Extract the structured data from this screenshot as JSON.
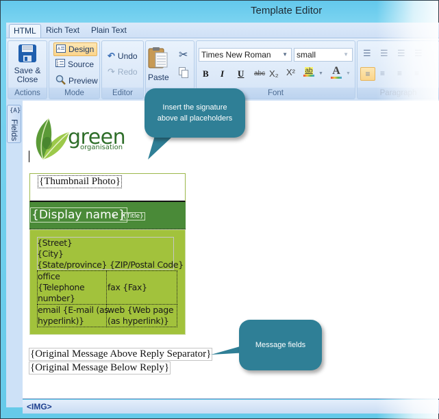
{
  "window": {
    "title": "Template Editor"
  },
  "tabs": [
    {
      "label": "HTML",
      "active": true
    },
    {
      "label": "Rich Text",
      "active": false
    },
    {
      "label": "Plain Text",
      "active": false
    }
  ],
  "ribbon": {
    "actions": {
      "label": "Actions",
      "save_close": "Save &\nClose",
      "save_line1": "Save &",
      "save_line2": "Close"
    },
    "mode": {
      "label": "Mode",
      "design": "Design",
      "source": "Source",
      "preview": "Preview",
      "selected": "Design"
    },
    "editor": {
      "label": "Editor",
      "undo": "Undo",
      "redo": "Redo"
    },
    "clipboard": {
      "paste": "Paste"
    },
    "font": {
      "label": "Font",
      "family": "Times New Roman",
      "size": "small",
      "bold": "B",
      "italic": "I",
      "underline": "U",
      "strike": "abc",
      "subscript": "X₂",
      "superscript": "X²",
      "highlight": "ab",
      "font_color": "A"
    },
    "paragraph": {
      "label": "Paragraph",
      "selected_align": "left"
    }
  },
  "side_panel": {
    "fields_label": "Fields",
    "fields_icon": "{A}"
  },
  "content": {
    "logo_text": "green",
    "logo_sub": "organisation",
    "thumbnail": "{Thumbnail Photo}",
    "display_name": "{Display name}",
    "separator": "-",
    "title": "{Title}",
    "street": "{Street}",
    "city": "{City}",
    "state_zip": "{State/province} {ZIP/Postal Code}",
    "office_1": "office",
    "office_2": "{Telephone",
    "office_3": "number}",
    "fax": "fax {Fax}",
    "email_1": "email {E-mail (as",
    "email_2": "hyperlink)}",
    "web_1": "web {Web page",
    "web_2": "(as hyperlink)}",
    "msg_above": "{Original Message Above Reply Separator}",
    "msg_below": "{Original Message Below Reply}"
  },
  "callouts": {
    "signature_line1": "Insert the signature",
    "signature_line2": "above all placeholders",
    "message": "Message fields"
  },
  "status": {
    "element": "<IMG>"
  },
  "colors": {
    "title_bar": "#63c8ec",
    "ribbon": "#dbe8f8",
    "callout": "#2f7f96",
    "name_band": "#4a8a38",
    "address_band": "#a2c23c",
    "logo_green": "#2f6e2a"
  }
}
